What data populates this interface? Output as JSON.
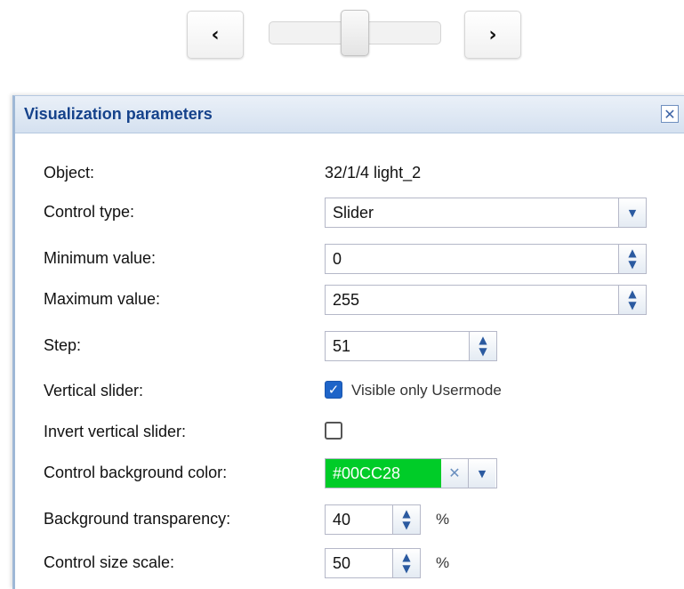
{
  "preview": {
    "prev_icon": "chevron-left-icon",
    "next_icon": "chevron-right-icon",
    "slider_value": 0.5
  },
  "dialog": {
    "title": "Visualization parameters",
    "close_icon": "close-icon"
  },
  "fields": {
    "object": {
      "label": "Object:",
      "value": "32/1/4 light_2"
    },
    "control_type": {
      "label": "Control type:",
      "value": "Slider"
    },
    "min_value": {
      "label": "Minimum value:",
      "value": "0"
    },
    "max_value": {
      "label": "Maximum value:",
      "value": "255"
    },
    "step": {
      "label": "Step:",
      "value": "51"
    },
    "vertical_slider": {
      "label": "Vertical slider:",
      "checked": true,
      "option_label": "Visible only Usermode"
    },
    "invert_vertical_slider": {
      "label": "Invert vertical slider:",
      "checked": false
    },
    "control_bg_color": {
      "label": "Control background color:",
      "value": "#00CC28"
    },
    "bg_transparency": {
      "label": "Background transparency:",
      "value": "40",
      "unit": "%"
    },
    "control_size_scale": {
      "label": "Control size scale:",
      "value": "50",
      "unit": "%"
    }
  },
  "colors": {
    "accent": "#15428b",
    "swatch": "#00CC28",
    "checkbox": "#1e64c8"
  }
}
